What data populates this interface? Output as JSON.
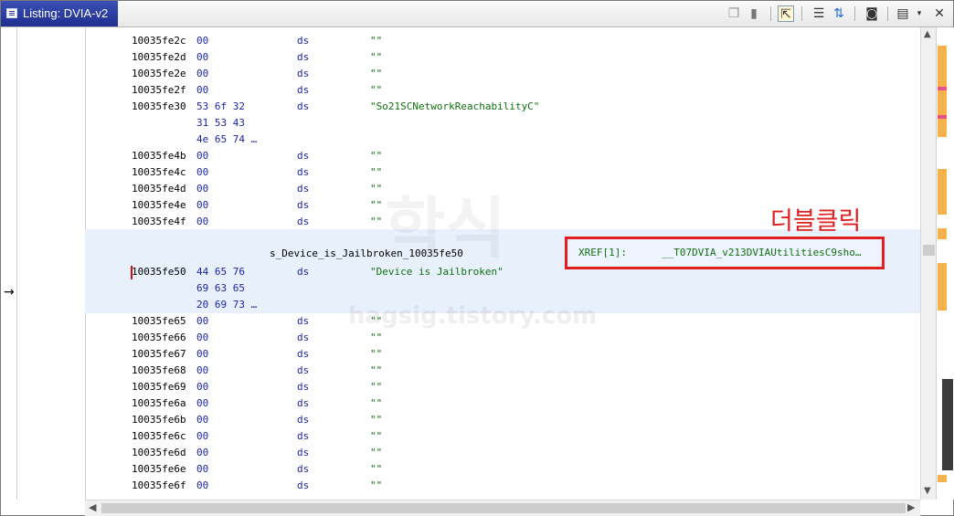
{
  "window": {
    "title": "Listing:  DVIA-v2"
  },
  "toolbar": {
    "icons": [
      "copy-icon",
      "paste-icon",
      "cursor-select-icon",
      "diff-icon",
      "arrows-icon",
      "snapshot-icon",
      "layout-icon",
      "dropdown-icon",
      "close-icon"
    ]
  },
  "listing": {
    "rows_before": [
      {
        "addr": "10035fe2c",
        "bytes": "00",
        "mnem": "ds",
        "oper": "\"\""
      },
      {
        "addr": "10035fe2d",
        "bytes": "00",
        "mnem": "ds",
        "oper": "\"\""
      },
      {
        "addr": "10035fe2e",
        "bytes": "00",
        "mnem": "ds",
        "oper": "\"\""
      },
      {
        "addr": "10035fe2f",
        "bytes": "00",
        "mnem": "ds",
        "oper": "\"\""
      },
      {
        "addr": "10035fe30",
        "bytes": "53 6f 32",
        "mnem": "ds",
        "oper": "\"So21SCNetworkReachabilityC\""
      },
      {
        "addr": "",
        "bytes": "31 53 43",
        "mnem": "",
        "oper": ""
      },
      {
        "addr": "",
        "bytes": "4e 65 74 …",
        "mnem": "",
        "oper": ""
      },
      {
        "addr": "10035fe4b",
        "bytes": "00",
        "mnem": "ds",
        "oper": "\"\""
      },
      {
        "addr": "10035fe4c",
        "bytes": "00",
        "mnem": "ds",
        "oper": "\"\""
      },
      {
        "addr": "10035fe4d",
        "bytes": "00",
        "mnem": "ds",
        "oper": "\"\""
      },
      {
        "addr": "10035fe4e",
        "bytes": "00",
        "mnem": "ds",
        "oper": "\"\""
      },
      {
        "addr": "10035fe4f",
        "bytes": "00",
        "mnem": "ds",
        "oper": "\"\""
      }
    ],
    "selected": {
      "label": "s_Device_is_Jailbroken_10035fe50",
      "addr": "10035fe50",
      "bytes": [
        "44 65 76",
        "69 63 65",
        "20 69 73 …"
      ],
      "mnem": "ds",
      "oper": "\"Device is Jailbroken\"",
      "xref_label": "XREF[1]:",
      "xref_value": "__T07DVIA_v213DVIAUtilitiesC9sho…"
    },
    "rows_after": [
      {
        "addr": "10035fe65",
        "bytes": "00",
        "mnem": "ds",
        "oper": "\"\""
      },
      {
        "addr": "10035fe66",
        "bytes": "00",
        "mnem": "ds",
        "oper": "\"\""
      },
      {
        "addr": "10035fe67",
        "bytes": "00",
        "mnem": "ds",
        "oper": "\"\""
      },
      {
        "addr": "10035fe68",
        "bytes": "00",
        "mnem": "ds",
        "oper": "\"\""
      },
      {
        "addr": "10035fe69",
        "bytes": "00",
        "mnem": "ds",
        "oper": "\"\""
      },
      {
        "addr": "10035fe6a",
        "bytes": "00",
        "mnem": "ds",
        "oper": "\"\""
      },
      {
        "addr": "10035fe6b",
        "bytes": "00",
        "mnem": "ds",
        "oper": "\"\""
      },
      {
        "addr": "10035fe6c",
        "bytes": "00",
        "mnem": "ds",
        "oper": "\"\""
      },
      {
        "addr": "10035fe6d",
        "bytes": "00",
        "mnem": "ds",
        "oper": "\"\""
      },
      {
        "addr": "10035fe6e",
        "bytes": "00",
        "mnem": "ds",
        "oper": "\"\""
      },
      {
        "addr": "10035fe6f",
        "bytes": "00",
        "mnem": "ds",
        "oper": "\"\""
      }
    ]
  },
  "annotation": {
    "text": "더블클릭",
    "color": "#e02020"
  },
  "watermark": {
    "main": "학식",
    "sub": "hagsig.tistory.com"
  },
  "margin": {
    "arrow": "→"
  }
}
